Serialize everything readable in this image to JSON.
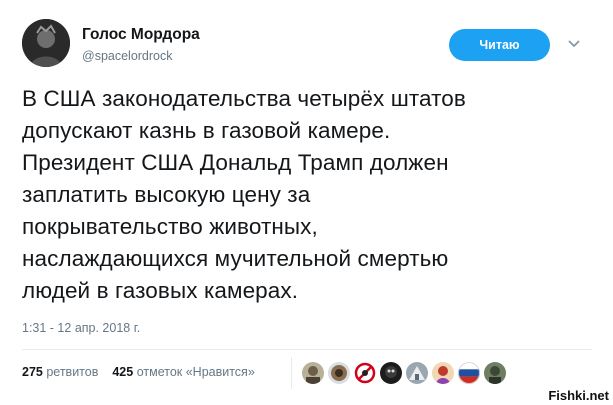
{
  "author": {
    "name": "Голос Мордора",
    "handle": "@spacelordrock"
  },
  "follow_label": "Читаю",
  "tweet_lines": [
    "В США законодательства четырёх штатов",
    "допускают казнь в газовой камере.",
    "Президент США Дональд Трамп должен",
    "заплатить высокую цену за",
    "покрывательство животных,",
    "наслаждающихся мучительной смертью",
    "людей в газовых камерах."
  ],
  "timestamp": "1:31 - 12 апр. 2018 г.",
  "stats": {
    "retweets_count": "275",
    "retweets_label": "ретвитов",
    "likes_count": "425",
    "likes_label": "отметок «Нравится»"
  },
  "watermark": "Fishki.net",
  "colors": {
    "accent": "#1da1f2",
    "text": "#14171a",
    "muted": "#657786"
  }
}
